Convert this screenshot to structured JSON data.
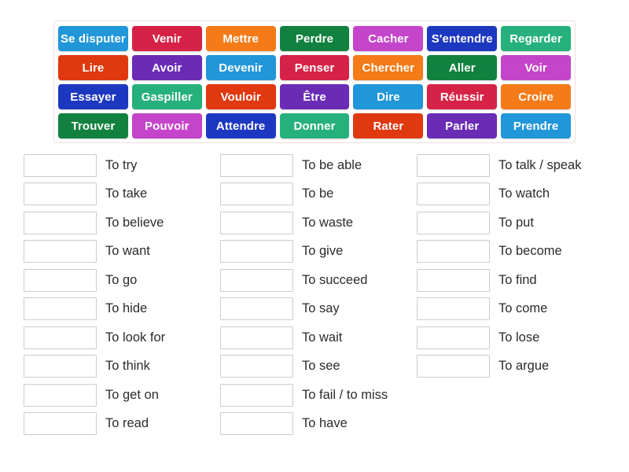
{
  "wordbank": {
    "rows": [
      [
        {
          "label": "Se disputer",
          "color": "#2196d9"
        },
        {
          "label": "Venir",
          "color": "#d62246"
        },
        {
          "label": "Mettre",
          "color": "#f47b18"
        },
        {
          "label": "Perdre",
          "color": "#12813f"
        },
        {
          "label": "Cacher",
          "color": "#c445ca"
        },
        {
          "label": "S'entendre",
          "color": "#1d38c0"
        },
        {
          "label": "Regarder",
          "color": "#26b07c"
        }
      ],
      [
        {
          "label": "Lire",
          "color": "#e0380f"
        },
        {
          "label": "Avoir",
          "color": "#6a2bb5"
        },
        {
          "label": "Devenir",
          "color": "#2196d9"
        },
        {
          "label": "Penser",
          "color": "#d62246"
        },
        {
          "label": "Chercher",
          "color": "#f47b18"
        },
        {
          "label": "Aller",
          "color": "#12813f"
        },
        {
          "label": "Voir",
          "color": "#c445ca"
        }
      ],
      [
        {
          "label": "Essayer",
          "color": "#1d38c0"
        },
        {
          "label": "Gaspiller",
          "color": "#26b07c"
        },
        {
          "label": "Vouloir",
          "color": "#e0380f"
        },
        {
          "label": "Être",
          "color": "#6a2bb5"
        },
        {
          "label": "Dire",
          "color": "#2196d9"
        },
        {
          "label": "Réussir",
          "color": "#d62246"
        },
        {
          "label": "Croire",
          "color": "#f47b18"
        }
      ],
      [
        {
          "label": "Trouver",
          "color": "#12813f"
        },
        {
          "label": "Pouvoir",
          "color": "#c445ca"
        },
        {
          "label": "Attendre",
          "color": "#1d38c0"
        },
        {
          "label": "Donner",
          "color": "#26b07c"
        },
        {
          "label": "Rater",
          "color": "#e0380f"
        },
        {
          "label": "Parler",
          "color": "#6a2bb5"
        },
        {
          "label": "Prendre",
          "color": "#2196d9"
        }
      ]
    ]
  },
  "answers": {
    "columns": [
      {
        "items": [
          {
            "label": "To try",
            "value": ""
          },
          {
            "label": "To take",
            "value": ""
          },
          {
            "label": "To believe",
            "value": ""
          },
          {
            "label": "To want",
            "value": ""
          },
          {
            "label": "To go",
            "value": ""
          },
          {
            "label": "To hide",
            "value": ""
          },
          {
            "label": "To look for",
            "value": ""
          },
          {
            "label": "To think",
            "value": ""
          },
          {
            "label": "To get on",
            "value": ""
          },
          {
            "label": "To read",
            "value": ""
          }
        ]
      },
      {
        "items": [
          {
            "label": "To be able",
            "value": ""
          },
          {
            "label": "To be",
            "value": ""
          },
          {
            "label": "To waste",
            "value": ""
          },
          {
            "label": "To give",
            "value": ""
          },
          {
            "label": "To succeed",
            "value": ""
          },
          {
            "label": "To say",
            "value": ""
          },
          {
            "label": "To wait",
            "value": ""
          },
          {
            "label": "To see",
            "value": ""
          },
          {
            "label": "To fail / to miss",
            "value": ""
          },
          {
            "label": "To have",
            "value": ""
          }
        ]
      },
      {
        "items": [
          {
            "label": "To talk / speak",
            "value": ""
          },
          {
            "label": "To watch",
            "value": ""
          },
          {
            "label": "To put",
            "value": ""
          },
          {
            "label": "To become",
            "value": ""
          },
          {
            "label": "To find",
            "value": ""
          },
          {
            "label": "To come",
            "value": ""
          },
          {
            "label": "To lose",
            "value": ""
          },
          {
            "label": "To argue",
            "value": ""
          }
        ]
      }
    ]
  }
}
